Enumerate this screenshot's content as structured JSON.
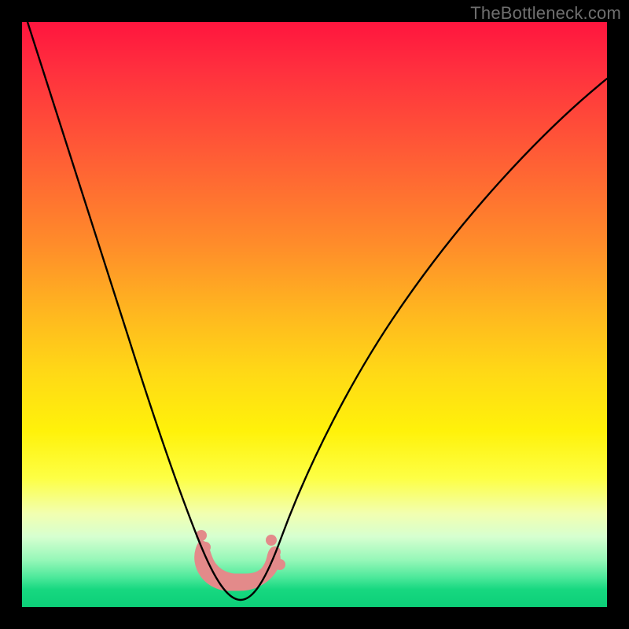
{
  "watermark": "TheBottleneck.com",
  "chart_data": {
    "type": "line",
    "title": "",
    "xlabel": "",
    "ylabel": "",
    "xlim": [
      0,
      100
    ],
    "ylim": [
      0,
      100
    ],
    "grid": false,
    "series": [
      {
        "name": "bottleneck-curve",
        "x": [
          0,
          2,
          6,
          10,
          14,
          18,
          22,
          25,
          27,
          29,
          31,
          33,
          34.5,
          36,
          37.5,
          39,
          41,
          43,
          46,
          50,
          55,
          60,
          66,
          72,
          80,
          88,
          96,
          100
        ],
        "y": [
          100,
          92,
          80,
          69,
          58,
          47,
          36,
          27,
          21,
          15,
          9.5,
          5.5,
          3,
          1.3,
          0.6,
          0.6,
          1.1,
          2.6,
          5.8,
          11,
          18,
          25,
          33,
          40,
          49,
          57,
          64,
          67
        ]
      }
    ],
    "marker_band": {
      "name": "optimal-range",
      "x_range": [
        30,
        42
      ],
      "y_level": 2
    },
    "colors": {
      "curve": "#000000",
      "marker": "#e38a8a",
      "gradient_top": "#ff153e",
      "gradient_bottom": "#0ccf78"
    }
  }
}
